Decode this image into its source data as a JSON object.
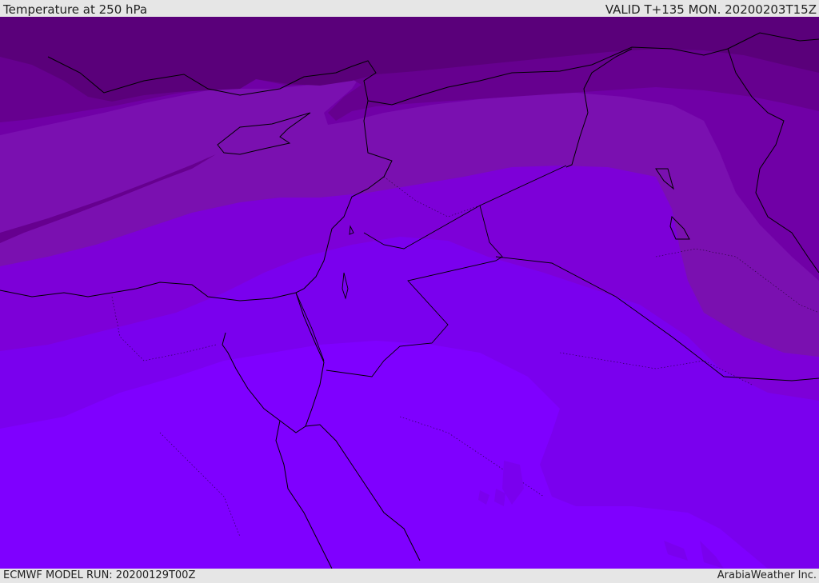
{
  "header": {
    "title": "Temperature at 250 hPa",
    "valid": "VALID T+135 MON. 20200203T15Z"
  },
  "footer": {
    "model_run": "ECMWF MODEL RUN: 20200129T00Z",
    "credit": "ArabiaWeather Inc."
  },
  "map": {
    "colors": {
      "band_darkest": "#5a007a",
      "band_dark": "#66008f",
      "band_mid_dark": "#7000a6",
      "band_mid": "#7a10b0",
      "band_light": "#7d00d8",
      "band_lighter": "#7a00ee",
      "band_lightest": "#7f00ff",
      "coast": "#000000"
    }
  }
}
